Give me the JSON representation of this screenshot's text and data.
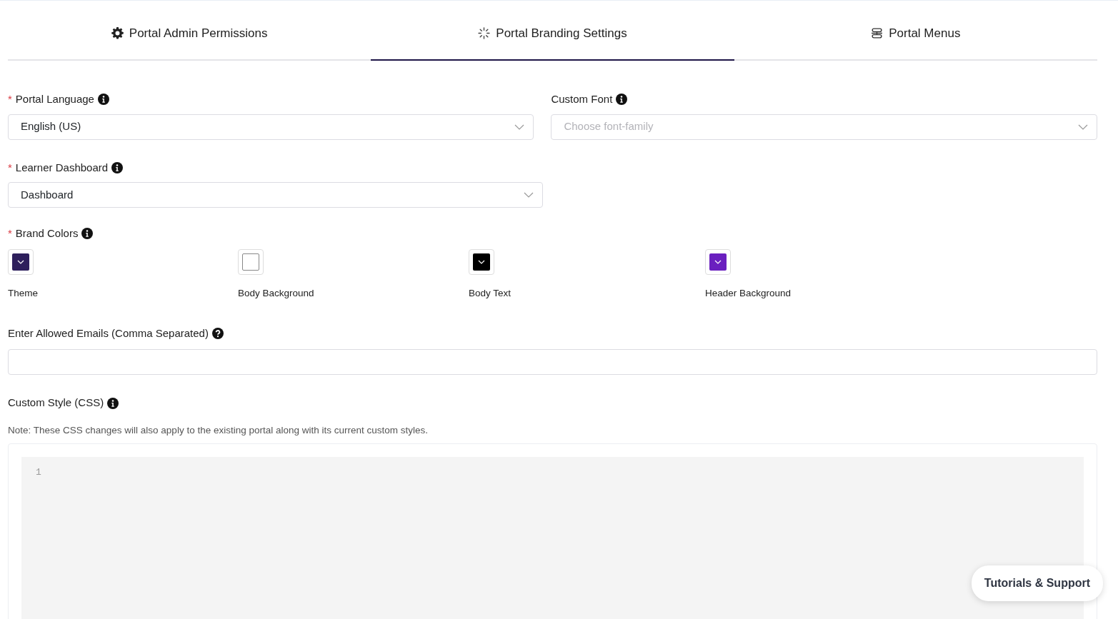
{
  "tabs": [
    {
      "label": "Portal Admin Permissions",
      "selected": false
    },
    {
      "label": "Portal Branding Settings",
      "selected": true
    },
    {
      "label": "Portal Menus",
      "selected": false
    }
  ],
  "portal_language": {
    "label": "Portal Language",
    "required_mark": "*",
    "value": "English (US)"
  },
  "custom_font": {
    "label": "Custom Font",
    "placeholder": "Choose font-family"
  },
  "learner_dashboard": {
    "label": "Learner Dashboard",
    "required_mark": "*",
    "value": "Dashboard"
  },
  "brand_colors": {
    "label": "Brand Colors",
    "required_mark": "*",
    "swatches": [
      {
        "label": "Theme",
        "color": "#2e1f5c"
      },
      {
        "label": "Body Background",
        "color": "#ffffff"
      },
      {
        "label": "Body Text",
        "color": "#000000"
      },
      {
        "label": "Header Background",
        "color": "#6a1fbf"
      }
    ]
  },
  "allowed_emails": {
    "label": "Enter Allowed Emails (Comma Separated)"
  },
  "custom_style": {
    "label": "Custom Style (CSS)",
    "note": "Note: These CSS changes will also apply to the existing portal along with its current custom styles.",
    "line_numbers": [
      "1"
    ]
  },
  "support_button": {
    "label": "Tutorials & Support"
  }
}
